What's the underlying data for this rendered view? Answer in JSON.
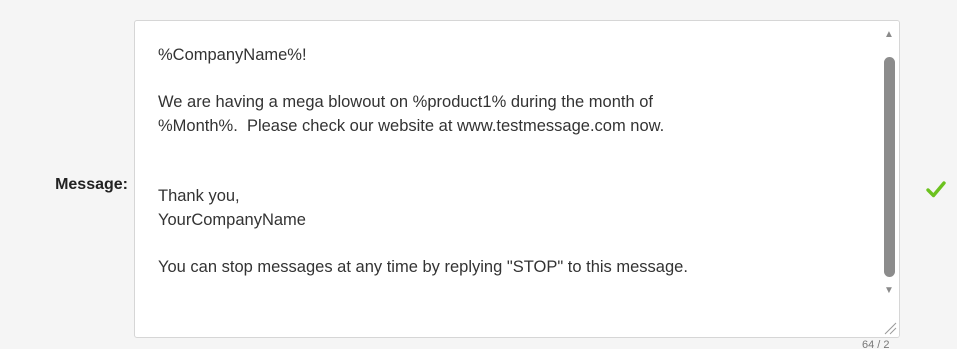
{
  "form": {
    "message_label": "Message:",
    "message_lines": [
      "%CompanyName%!",
      "",
      "We are having a mega blowout on %product1% during the month of",
      "%Month%.  Please check our website at www.testmessage.com now.",
      "",
      "",
      "Thank you,",
      "YourCompanyName",
      "",
      "You can stop messages at any time by replying \"STOP\" to this message."
    ],
    "char_counter": "64 / 2",
    "validation_icon": "checkmark-icon",
    "validation_color": "#6cc21f"
  }
}
